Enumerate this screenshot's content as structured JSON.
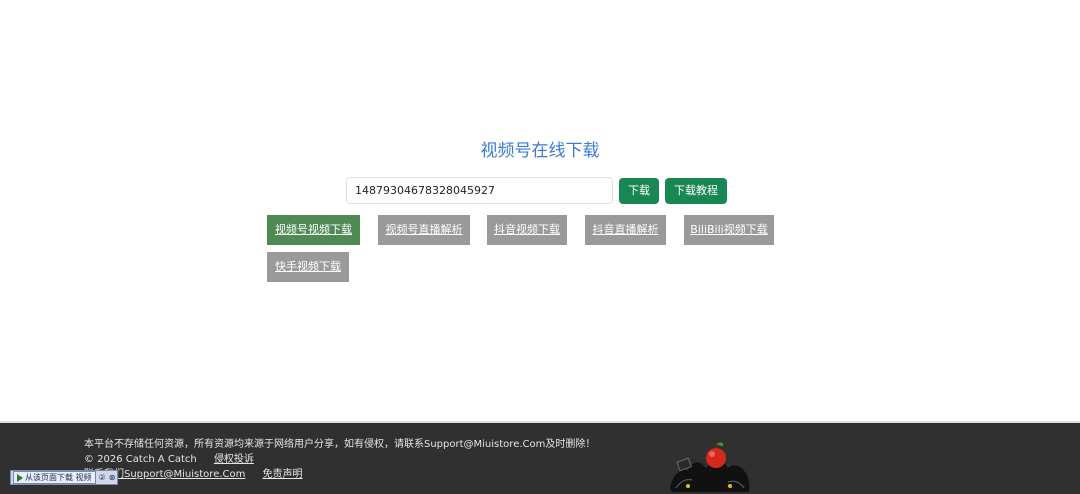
{
  "title": "视频号在线下载",
  "search": {
    "value": "14879304678328045927",
    "placeholder": ""
  },
  "buttons": {
    "download": "下载",
    "tutorial": "下载教程"
  },
  "nav": {
    "tabs": [
      {
        "label": "视频号视频下载",
        "active": true
      },
      {
        "label": "视频号直播解析",
        "active": false
      },
      {
        "label": "抖音视频下载",
        "active": false
      },
      {
        "label": "抖音直播解析",
        "active": false
      },
      {
        "label": "BiliBili视频下载",
        "active": false
      },
      {
        "label": "快手视频下载",
        "active": false
      }
    ]
  },
  "footer": {
    "disclaimer": "本平台不存储任何资源，所有资源均来源于网络用户分享，如有侵权，请联系Support@Miuistore.Com及时删除！",
    "copyright": "© 2026 Catch A Catch",
    "complaint_link": "侵权投诉",
    "contact_link": "联系我们Support@Miuistore.Com",
    "disclaimer_link": "免责声明"
  },
  "toolbar": {
    "main_label": "从该页面下载 视频",
    "help": "②",
    "close": "⊗"
  },
  "colors": {
    "title": "#3a7bd5",
    "button_green": "#198754",
    "tab_active": "#4f8a55",
    "tab_inactive": "#9a9a9a",
    "footer_bg": "#303030"
  }
}
